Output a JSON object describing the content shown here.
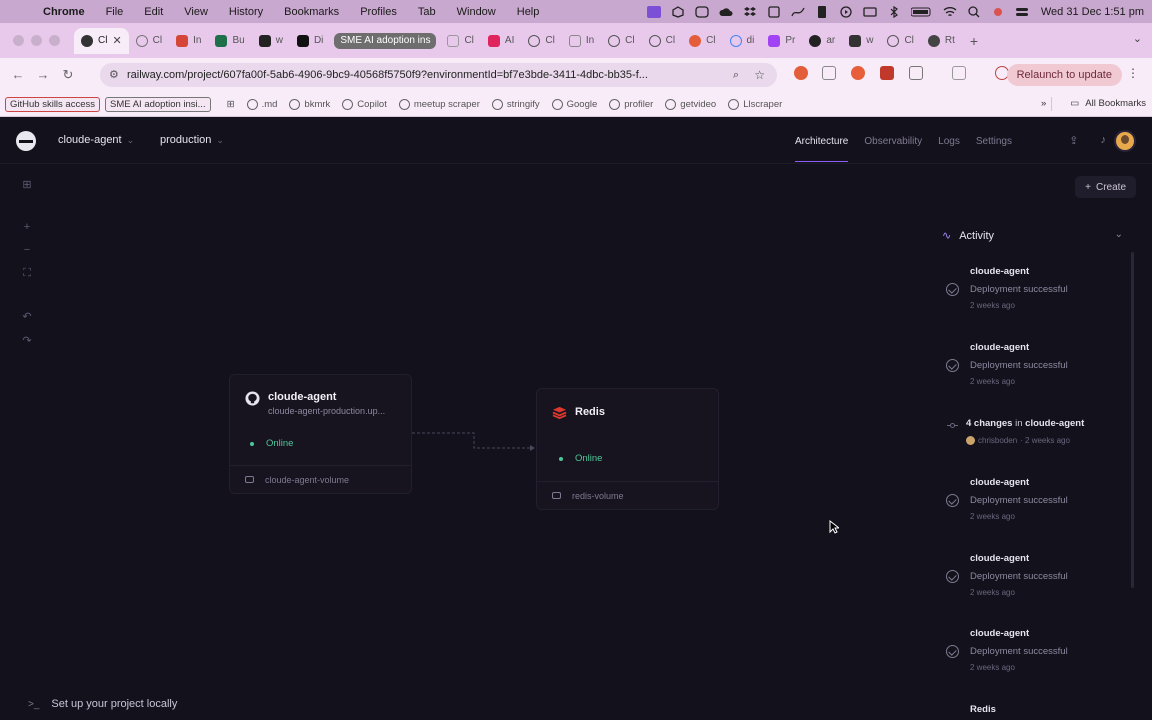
{
  "menubar": {
    "app": "Chrome",
    "items": [
      "File",
      "Edit",
      "View",
      "History",
      "Bookmarks",
      "Profiles",
      "Tab",
      "Window",
      "Help"
    ],
    "clock": "Wed 31 Dec  1:51 pm"
  },
  "tabs": [
    {
      "label": "Cl",
      "color": "#333333"
    },
    {
      "label": "Cl",
      "color": "#777777"
    },
    {
      "label": "In",
      "color": "#d44638"
    },
    {
      "label": "Bu",
      "color": "#1f6f4a"
    },
    {
      "label": "w",
      "color": "#222222"
    },
    {
      "label": "Di",
      "color": "#111111"
    },
    {
      "label": "SME AI adoption ins",
      "color": "#6e6e6e"
    },
    {
      "label": "Cl",
      "color": "#999999"
    },
    {
      "label": "AI",
      "color": "#e0245e"
    },
    {
      "label": "Cl",
      "color": "#555555"
    },
    {
      "label": "In",
      "color": "#888888"
    },
    {
      "label": "Cl",
      "color": "#555555"
    },
    {
      "label": "Cl",
      "color": "#555555"
    },
    {
      "label": "Cl",
      "color": "#e35d3a"
    },
    {
      "label": "di",
      "color": "#4285f4"
    },
    {
      "label": "Pr",
      "color": "#a142f4"
    },
    {
      "label": "ar",
      "color": "#222222"
    },
    {
      "label": "w",
      "color": "#333333"
    },
    {
      "label": "Cl",
      "color": "#555555"
    },
    {
      "label": "Rt",
      "color": "#444444"
    }
  ],
  "address": {
    "url": "railway.com/project/607fa00f-5ab6-4906-9bc9-40568f5750f9?environmentId=bf7e3bde-3411-4dbc-bb35-f...",
    "relaunch": "Relaunch to update"
  },
  "bookmarks": {
    "chips": [
      "GitHub skills access",
      "SME AI adoption insi..."
    ],
    "items": [
      ".md",
      "bkmrk",
      "Copilot",
      "meetup scraper",
      "stringify",
      "Google",
      "profiler",
      "getvideo",
      "Llscraper"
    ],
    "all": "All Bookmarks"
  },
  "railway": {
    "project": "cloude-agent",
    "environment": "production",
    "nav": [
      "Architecture",
      "Observability",
      "Logs",
      "Settings"
    ],
    "create": "Create",
    "services": [
      {
        "name": "cloude-agent",
        "domain": "cloude-agent-production.up...",
        "status": "Online",
        "volume": "cloude-agent-volume",
        "icon": "github-icon"
      },
      {
        "name": "Redis",
        "status": "Online",
        "volume": "redis-volume",
        "icon": "redis-icon"
      }
    ],
    "activity": {
      "title": "Activity",
      "events": [
        {
          "service": "cloude-agent",
          "message": "Deployment successful",
          "time": "2 weeks ago"
        },
        {
          "service": "cloude-agent",
          "message": "Deployment successful",
          "time": "2 weeks ago"
        },
        {
          "changes": "4 changes",
          "in": "in",
          "service": "cloude-agent",
          "author": "chrisboden",
          "time": "· 2 weeks ago"
        },
        {
          "service": "cloude-agent",
          "message": "Deployment successful",
          "time": "2 weeks ago"
        },
        {
          "service": "cloude-agent",
          "message": "Deployment successful",
          "time": "2 weeks ago"
        },
        {
          "service": "cloude-agent",
          "message": "Deployment successful",
          "time": "2 weeks ago"
        },
        {
          "service": "Redis"
        }
      ]
    },
    "setup": "Set up your project locally"
  }
}
